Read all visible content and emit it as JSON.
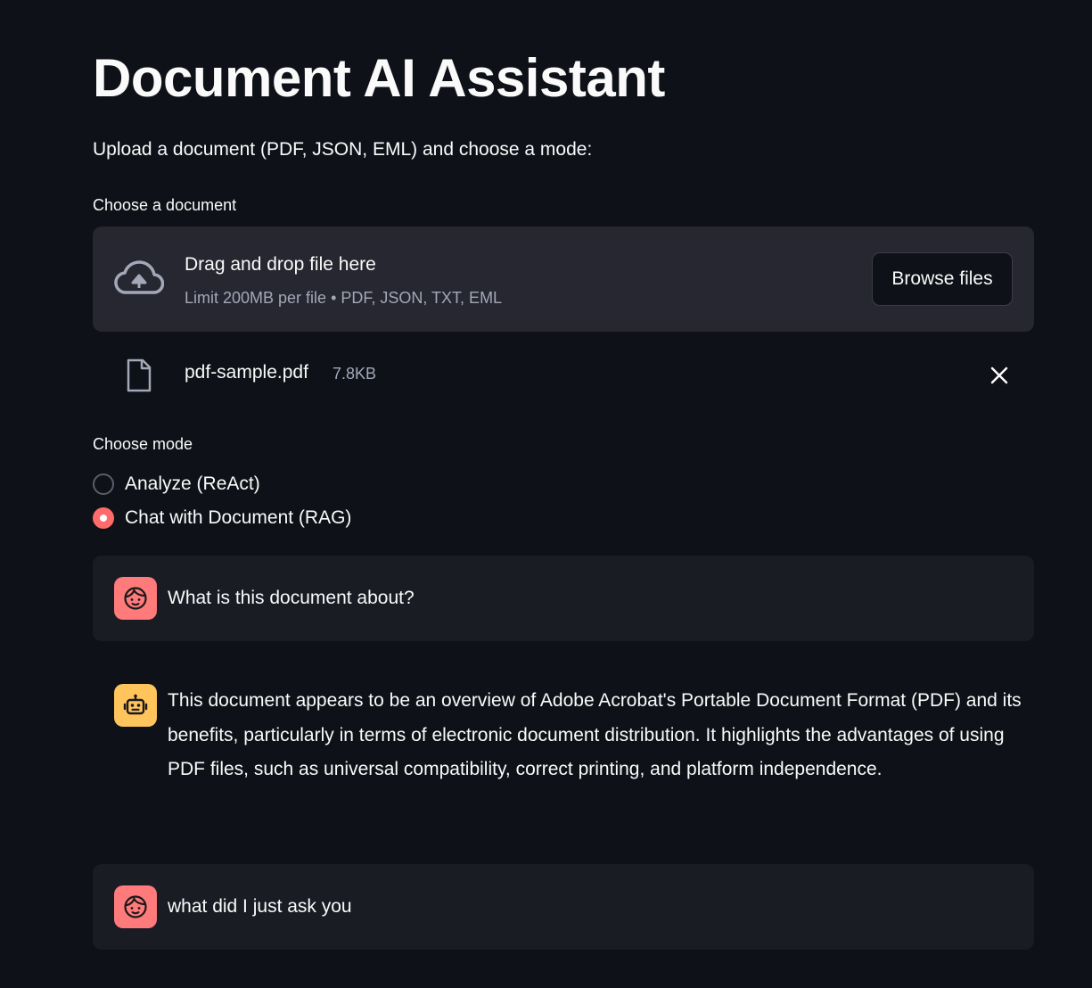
{
  "page": {
    "title": "Document AI Assistant",
    "subtitle": "Upload a document (PDF, JSON, EML) and choose a mode:"
  },
  "uploader": {
    "label": "Choose a document",
    "drag_text": "Drag and drop file here",
    "limit_text": "Limit 200MB per file • PDF, JSON, TXT, EML",
    "browse_label": "Browse files",
    "icon": "cloud-upload-icon"
  },
  "uploaded_file": {
    "name": "pdf-sample.pdf",
    "size": "7.8KB",
    "icon": "file-icon"
  },
  "mode": {
    "label": "Choose mode",
    "options": [
      {
        "label": "Analyze (ReAct)",
        "selected": false
      },
      {
        "label": "Chat with Document (RAG)",
        "selected": true
      }
    ]
  },
  "chat": {
    "messages": [
      {
        "role": "user",
        "text": "What is this document about?"
      },
      {
        "role": "assistant",
        "text": "This document appears to be an overview of Adobe Acrobat's Portable Document Format (PDF) and its benefits, particularly in terms of electronic document distribution. It highlights the advantages of using PDF files, such as universal compatibility, correct printing, and platform independence."
      },
      {
        "role": "user",
        "text": "what did I just ask you"
      }
    ]
  },
  "colors": {
    "background": "#0e1117",
    "panel": "#262730",
    "user_message_bg": "#1a1c24",
    "accent": "#ff6b6b",
    "user_avatar": "#ff7a7a",
    "assistant_avatar": "#ffc55c",
    "muted_text": "#a3a8b8"
  }
}
